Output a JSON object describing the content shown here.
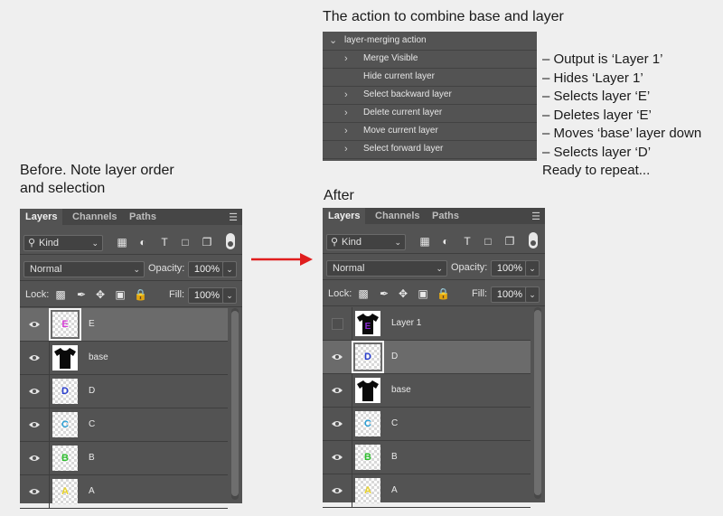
{
  "headings": {
    "action_title": "The action to combine base and layer",
    "before": [
      "Before. Note layer order",
      "and selection"
    ],
    "after": "After"
  },
  "actions_panel": {
    "rows": [
      {
        "label": "layer-merging action",
        "chevron": "⌄",
        "level": 0
      },
      {
        "label": "Merge Visible",
        "chevron": "›",
        "level": 1
      },
      {
        "label": "Hide current layer",
        "chevron": "",
        "level": 1
      },
      {
        "label": "Select backward layer",
        "chevron": "›",
        "level": 1
      },
      {
        "label": "Delete current layer",
        "chevron": "›",
        "level": 1
      },
      {
        "label": "Move current layer",
        "chevron": "›",
        "level": 1
      },
      {
        "label": "Select forward layer",
        "chevron": "›",
        "level": 1
      }
    ]
  },
  "notes": [
    "– Output is ‘Layer 1’",
    "– Hides ‘Layer 1’",
    "– Selects layer ‘E’",
    "– Deletes layer ‘E’",
    "– Moves ‘base’ layer down",
    "– Selects layer ‘D’",
    "Ready to repeat..."
  ],
  "panel_ui": {
    "tabs": [
      "Layers",
      "Channels",
      "Paths"
    ],
    "kind_label": "Kind",
    "blend_mode": "Normal",
    "opacity_label": "Opacity:",
    "opacity_value": "100%",
    "lock_label": "Lock:",
    "fill_label": "Fill:",
    "fill_value": "100%"
  },
  "before_layers": [
    {
      "name": "E",
      "thumb": "letter",
      "letter": "E",
      "color": "#d63fd6",
      "visible": true,
      "selected": true
    },
    {
      "name": "base",
      "thumb": "shirt",
      "visible": true,
      "selected": false
    },
    {
      "name": "D",
      "thumb": "letter",
      "letter": "D",
      "color": "#2a3fd0",
      "visible": true,
      "selected": false
    },
    {
      "name": "C",
      "thumb": "letter",
      "letter": "C",
      "color": "#2a9fd6",
      "visible": true,
      "selected": false
    },
    {
      "name": "B",
      "thumb": "letter",
      "letter": "B",
      "color": "#2fbf2f",
      "visible": true,
      "selected": false
    },
    {
      "name": "A",
      "thumb": "letter",
      "letter": "A",
      "color": "#e8d22a",
      "visible": true,
      "selected": false
    }
  ],
  "after_layers": [
    {
      "name": "Layer 1",
      "thumb": "shirt-e",
      "visible": false,
      "selected": false
    },
    {
      "name": "D",
      "thumb": "letter",
      "letter": "D",
      "color": "#2a3fd0",
      "visible": true,
      "selected": true
    },
    {
      "name": "base",
      "thumb": "shirt",
      "visible": true,
      "selected": false
    },
    {
      "name": "C",
      "thumb": "letter",
      "letter": "C",
      "color": "#2a9fd6",
      "visible": true,
      "selected": false
    },
    {
      "name": "B",
      "thumb": "letter",
      "letter": "B",
      "color": "#2fbf2f",
      "visible": true,
      "selected": false
    },
    {
      "name": "A",
      "thumb": "letter",
      "letter": "A",
      "color": "#e8d22a",
      "visible": true,
      "selected": false
    }
  ],
  "colors": {
    "arrow": "#e01e1e",
    "panel": "#535353",
    "selected_row": "#6b6b6b"
  }
}
